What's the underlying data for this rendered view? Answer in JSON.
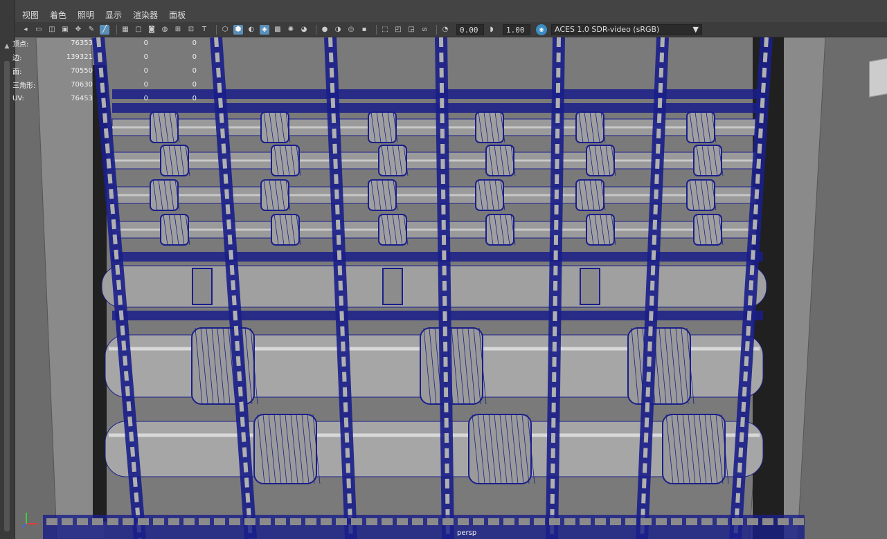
{
  "menubar": {
    "items": [
      "视图",
      "着色",
      "照明",
      "显示",
      "渲染器",
      "面板"
    ]
  },
  "toolbar": {
    "exposure_value": "0.00",
    "gamma_value": "1.00",
    "colorspace_label": "ACES 1.0 SDR-video (sRGB)"
  },
  "hud": {
    "rows": [
      {
        "label": "顶点:",
        "v1": "76353",
        "v2": "0",
        "v3": "0"
      },
      {
        "label": "边:",
        "v1": "139321",
        "v2": "0",
        "v3": "0"
      },
      {
        "label": "面:",
        "v1": "70550",
        "v2": "0",
        "v3": "0"
      },
      {
        "label": "三角形:",
        "v1": "70630",
        "v2": "0",
        "v3": "0"
      },
      {
        "label": "UV:",
        "v1": "76453",
        "v2": "0",
        "v3": "0"
      }
    ]
  },
  "viewport": {
    "camera_label": "persp"
  },
  "colors": {
    "viewport_bg": "#6c6c6c",
    "wire": "#1a1f8a",
    "active_tool": "#5a8fb8"
  }
}
